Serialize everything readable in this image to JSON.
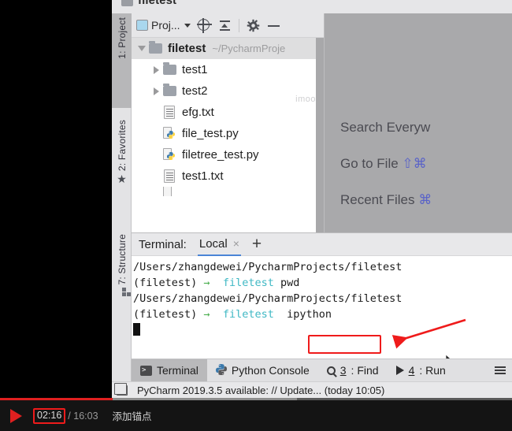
{
  "window": {
    "title": "filetest"
  },
  "tool_strip": {
    "items": [
      {
        "label": "1: Project",
        "icon": "folder-icon",
        "active": true
      },
      {
        "label": "2: Favorites",
        "icon": "star-icon",
        "active": false
      },
      {
        "label": "7: Structure",
        "icon": "structure-icon",
        "active": false
      }
    ]
  },
  "project_toolbar": {
    "select_label": "Proj...",
    "icons": [
      "locate-target-icon",
      "collapse-all-icon",
      "settings-gear-icon",
      "minimize-icon"
    ]
  },
  "project_tree": {
    "root": {
      "name": "filetest",
      "path": "~/PycharmProje",
      "icon": "folder-icon",
      "expanded": true
    },
    "children": [
      {
        "name": "test1",
        "icon": "folder-icon",
        "expandable": true
      },
      {
        "name": "test2",
        "icon": "folder-icon",
        "expandable": true
      },
      {
        "name": "efg.txt",
        "icon": "text-file-icon",
        "expandable": false
      },
      {
        "name": "file_test.py",
        "icon": "python-file-icon",
        "expandable": false
      },
      {
        "name": "filetree_test.py",
        "icon": "python-file-icon",
        "expandable": false
      },
      {
        "name": "test1.txt",
        "icon": "text-file-icon",
        "expandable": false
      }
    ],
    "watermark": "imooc"
  },
  "editor_hints": {
    "rows": [
      {
        "text": "Search Everyw",
        "keys": ""
      },
      {
        "text": "Go to File ",
        "keys": "⇧⌘"
      },
      {
        "text": "Recent Files ",
        "keys": "⌘"
      }
    ]
  },
  "terminal": {
    "label": "Terminal:",
    "tab_name": "Local",
    "close_glyph": "×",
    "add_glyph": "+",
    "lines": [
      {
        "type": "plain",
        "text": "/Users/zhangdewei/PycharmProjects/filetest"
      },
      {
        "type": "prompt",
        "env": "(filetest)",
        "arrow": "→",
        "branch": "filetest",
        "command": "pwd"
      },
      {
        "type": "plain",
        "text": "/Users/zhangdewei/PycharmProjects/filetest"
      },
      {
        "type": "prompt",
        "env": "(filetest)",
        "arrow": "→",
        "branch": "filetest",
        "command": "ipython"
      }
    ],
    "highlighted_command": "ipython",
    "highlight_color": "#ef1b1b"
  },
  "bottom_tabs": {
    "items": [
      {
        "label": "Terminal",
        "num": "",
        "icon": "terminal-icon",
        "active": true
      },
      {
        "label": "Python Console",
        "num": "",
        "icon": "python-icon",
        "active": false
      },
      {
        "label": ": Find",
        "num": "3",
        "icon": "search-icon",
        "active": false
      },
      {
        "label": ": Run",
        "num": "4",
        "icon": "play-icon",
        "active": false
      }
    ],
    "overflow_icon": "list-menu-icon"
  },
  "status_bar": {
    "icon": "layout-icon",
    "message": "PyCharm 2019.3.5 available: // Update... (today 10:05)"
  },
  "player": {
    "play_icon": "play-icon",
    "current_time": "02:16",
    "separator": "/",
    "total_time": "16:03",
    "anchor_label": "添加锚点",
    "progress_percent": 22,
    "buffer_percent": 58,
    "accent_color": "#e02020"
  }
}
